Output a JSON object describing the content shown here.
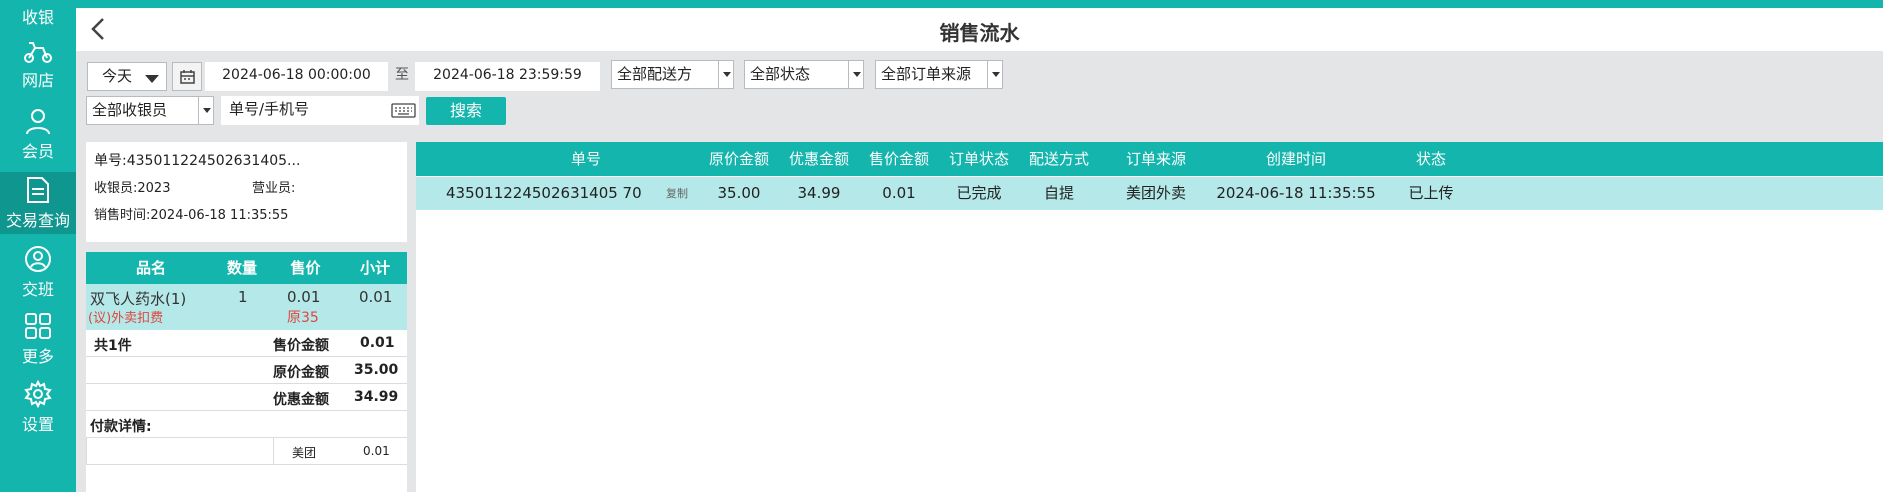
{
  "sidebar": {
    "items": [
      {
        "label": "收银",
        "icon": "cashier-icon"
      },
      {
        "label": "网店",
        "icon": "scooter-icon"
      },
      {
        "label": "会员",
        "icon": "member-icon"
      },
      {
        "label": "交易查询",
        "icon": "document-icon"
      },
      {
        "label": "交班",
        "icon": "shift-icon"
      },
      {
        "label": "更多",
        "icon": "grid-icon"
      },
      {
        "label": "设置",
        "icon": "gear-icon"
      }
    ],
    "active": "交易查询"
  },
  "header": {
    "title": "销售流水"
  },
  "filters": {
    "period": "今天",
    "start_datetime": "2024-06-18 00:00:00",
    "to_label": "至",
    "end_datetime": "2024-06-18 23:59:59",
    "delivery": "全部配送方",
    "status": "全部状态",
    "source": "全部订单来源",
    "cashier": "全部收银员",
    "search_placeholder": "单号/手机号",
    "search_button": "搜索"
  },
  "order_info": {
    "order_no": "单号:435011224502631405...",
    "cashier": "收银员:2023",
    "salesperson": "营业员:",
    "sale_time": "销售时间:2024-06-18 11:35:55"
  },
  "items_table": {
    "headers": [
      "品名",
      "数量",
      "售价",
      "小计"
    ],
    "rows": [
      {
        "name": "双飞人药水(1)",
        "note": "(议)外卖扣费",
        "qty": "1",
        "price": "0.01",
        "original": "原35",
        "subtotal": "0.01"
      }
    ]
  },
  "summary": {
    "count": "共1件",
    "sale_amount_label": "售价金额",
    "sale_amount": "0.01",
    "original_amount_label": "原价金额",
    "original_amount": "35.00",
    "discount_amount_label": "优惠金额",
    "discount_amount": "34.99",
    "payment_label": "付款详情:",
    "payment_method": "美团",
    "payment_amount": "0.01"
  },
  "orders_table": {
    "headers": [
      "单号",
      "原价金额",
      "优惠金额",
      "售价金额",
      "订单状态",
      "配送方式",
      "订单来源",
      "创建时间",
      "状态"
    ],
    "rows": [
      {
        "order_no": "435011224502631405 70",
        "copy": "复制",
        "original": "35.00",
        "discount": "34.99",
        "sale": "0.01",
        "order_status": "已完成",
        "delivery": "自提",
        "source": "美团外卖",
        "created": "2024-06-18 11:35:55",
        "status": "已上传"
      }
    ]
  },
  "colors": {
    "accent": "#13b5ad",
    "row_highlight": "#b5e8e8",
    "note_red": "#e0463c"
  }
}
